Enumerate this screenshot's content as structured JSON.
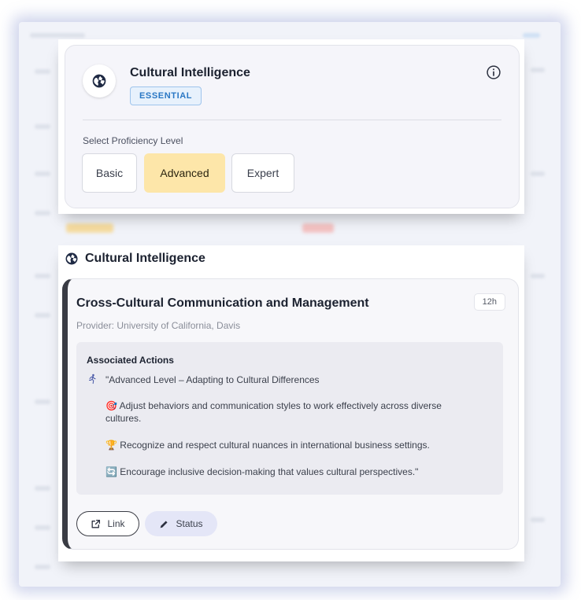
{
  "skill_card": {
    "title": "Cultural Intelligence",
    "badge": "ESSENTIAL",
    "proficiency_label": "Select Proficiency Level",
    "levels": [
      {
        "label": "Basic",
        "selected": false
      },
      {
        "label": "Advanced",
        "selected": true
      },
      {
        "label": "Expert",
        "selected": false
      }
    ]
  },
  "section": {
    "title": "Cultural Intelligence"
  },
  "course": {
    "title": "Cross-Cultural Communication and Management",
    "duration": "12h",
    "provider": "Provider: University of California, Davis",
    "actions_heading": "Associated Actions",
    "actions": {
      "intro": "\"Advanced Level – Adapting to Cultural Differences",
      "item1_emoji": "🎯",
      "item1_line1": "Adjust behaviors and communication styles to work effectively across diverse",
      "item1_line2": "cultures.",
      "item2_emoji": "🏆",
      "item2": "Recognize and respect cultural nuances in international business settings.",
      "item3_emoji": "🔄",
      "item3": "Encourage inclusive decision-making that values cultural perspectives.\""
    },
    "link_label": "Link",
    "status_label": "Status"
  },
  "colors": {
    "selected_level": "#fde6a9",
    "badge_text": "#2a77c4",
    "status_button": "#e4e6f7"
  }
}
